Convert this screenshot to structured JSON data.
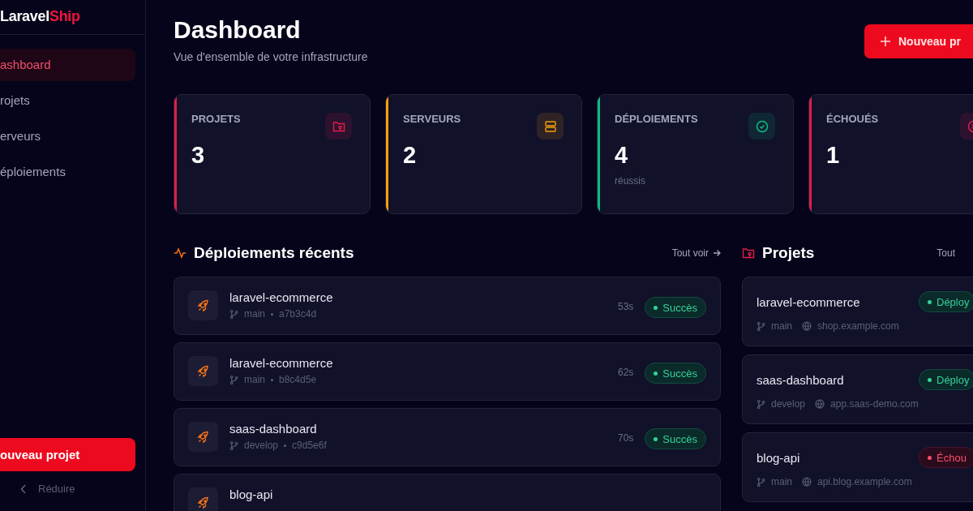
{
  "sidebar": {
    "logo_part_1": "Laravel",
    "logo_part_2": "Ship",
    "nav": [
      {
        "label": "ashboard",
        "selected": true
      },
      {
        "label": "rojets",
        "selected": false
      },
      {
        "label": "erveurs",
        "selected": false
      },
      {
        "label": "éploiements",
        "selected": false
      }
    ],
    "new_button": "ouveau projet",
    "collapse": "Réduire"
  },
  "header": {
    "title": "Dashboard",
    "subtitle": "Vue d'ensemble de votre infrastructure",
    "button": "Nouveau pr"
  },
  "stats": [
    {
      "kind": "projects",
      "label": "PROJETS",
      "value": "3",
      "color": "#e11d48"
    },
    {
      "kind": "servers",
      "label": "SERVEURS",
      "value": "2",
      "color": "#f59e0b"
    },
    {
      "kind": "deploys",
      "label": "DÉPLOIEMENTS",
      "value": "4",
      "note": "réussis",
      "color": "#10b981"
    },
    {
      "kind": "failed",
      "label": "ÉCHOUÉS",
      "value": "1",
      "color": "#e11d48"
    }
  ],
  "recent": {
    "title": "Déploiements récents",
    "link": "Tout voir",
    "items": [
      {
        "project": "laravel-ecommerce",
        "branch": "main",
        "commit": "a7b3c4d",
        "duration": "53s",
        "kind": "success",
        "status_label": "Succès"
      },
      {
        "project": "laravel-ecommerce",
        "branch": "main",
        "commit": "b8c4d5e",
        "duration": "62s",
        "kind": "success",
        "status_label": "Succès"
      },
      {
        "project": "saas-dashboard",
        "branch": "develop",
        "commit": "c9d5e6f",
        "duration": "70s",
        "kind": "success",
        "status_label": "Succès"
      },
      {
        "project": "blog-api"
      }
    ]
  },
  "projects": {
    "title": "Projets",
    "link": "Tout",
    "items": [
      {
        "name": "laravel-ecommerce",
        "branch": "main",
        "domain": "shop.example.com",
        "kind": "success",
        "status_label": "Déploy"
      },
      {
        "name": "saas-dashboard",
        "branch": "develop",
        "domain": "app.saas-demo.com",
        "kind": "success",
        "status_label": "Déploy"
      },
      {
        "name": "blog-api",
        "branch": "main",
        "domain": "api.blog.example.com",
        "kind": "failed",
        "status_label": "Échou"
      }
    ]
  }
}
